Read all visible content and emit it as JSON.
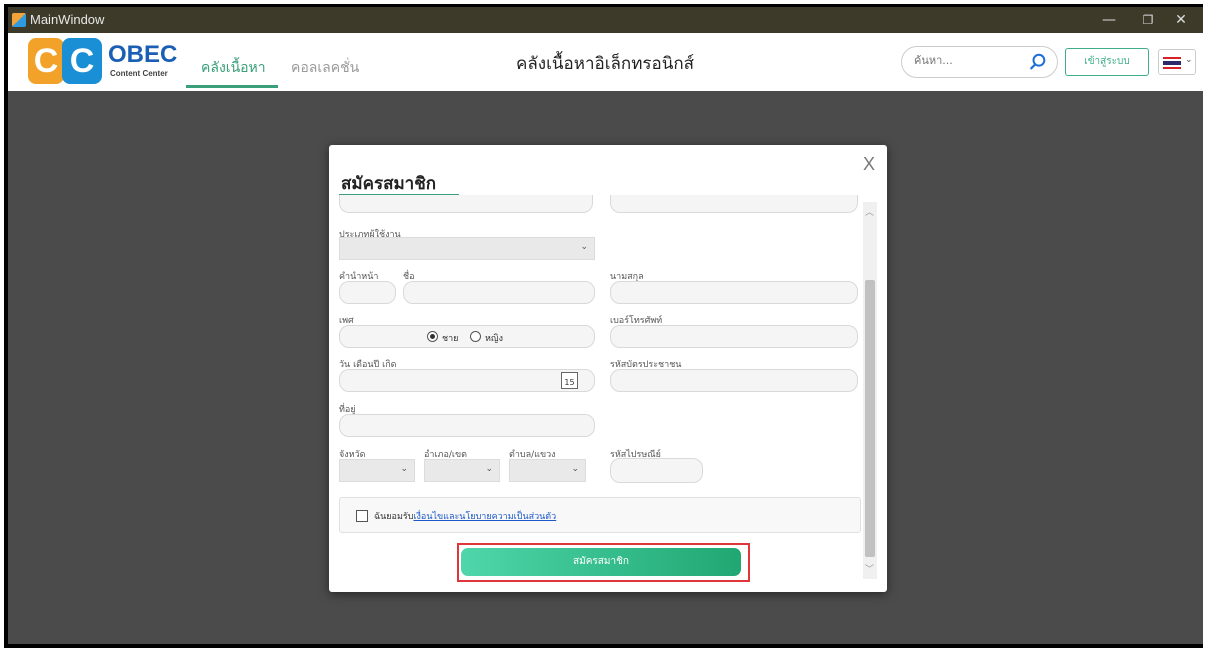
{
  "window": {
    "title": "MainWindow",
    "controls": [
      "—",
      "❐",
      "✕"
    ]
  },
  "logo": {
    "c1": "C",
    "c2": "C",
    "brand": "OBEC",
    "sub": "Content Center"
  },
  "nav": {
    "tab_content": "คลังเนื้อหา",
    "tab_collection": "คอลเลคชั่น"
  },
  "app_title": "คลังเนื้อหาอิเล็กทรอนิกส์",
  "search": {
    "placeholder": "ค้นหา..."
  },
  "login_label": "เข้าสู่ระบบ",
  "language": "TH",
  "modal": {
    "close": "X",
    "heading": "สมัครสมาชิก",
    "user_type_label": "ประเภทผู้ใช้งาน",
    "prefix_label": "คำนำหน้า",
    "first_name_label": "ชื่อ",
    "last_name_label": "นามสกุล",
    "gender_label": "เพศ",
    "gender_male": "ชาย",
    "gender_female": "หญิง",
    "phone_label": "เบอร์โทรศัพท์",
    "birthdate_label": "วัน เดือนปี เกิด",
    "calendar_day": "15",
    "id_card_label": "รหัสบัตรประชาชน",
    "address_label": "ที่อยู่",
    "province_label": "จังหวัด",
    "district_label": "อำเภอ/เขต",
    "subdistrict_label": "ตำบล/แขวง",
    "postal_label": "รหัสไปรษณีย์",
    "consent_prefix": "ฉันยอมรับ",
    "consent_link": "เงื่อนไขและนโยบายความเป็นส่วนตัว",
    "submit": "สมัครสมาชิก"
  }
}
